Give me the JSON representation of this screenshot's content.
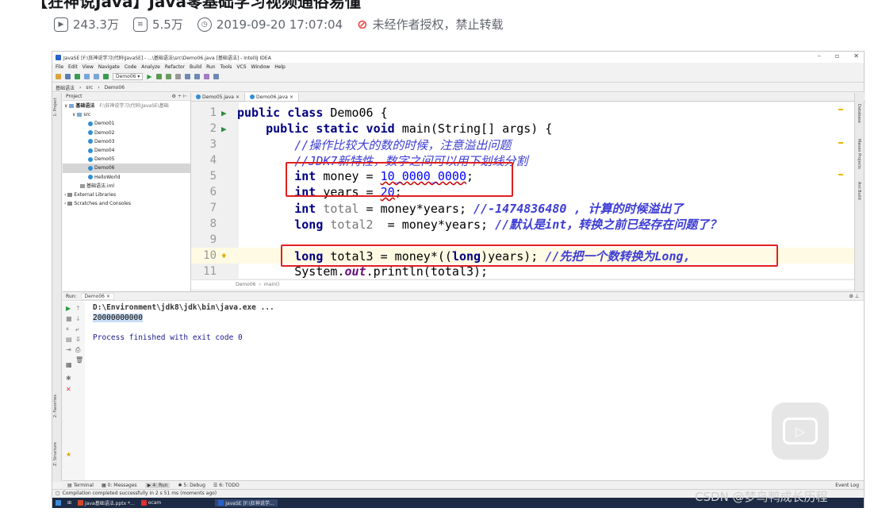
{
  "page": {
    "title": "【狂神说Java】Java零基础学习视频通俗易懂",
    "views": "243.3万",
    "danmaku": "5.5万",
    "date": "2019-09-20 17:07:04",
    "notice": "未经作者授权，禁止转载"
  },
  "ide": {
    "window_title": "JavaSE [F:\\狂神说学习\\代码\\JavaSE] - ...\\基础语法\\src\\Demo06.java [基础语法] - IntelliJ IDEA",
    "menu": [
      "File",
      "Edit",
      "View",
      "Navigate",
      "Code",
      "Analyze",
      "Refactor",
      "Build",
      "Run",
      "Tools",
      "VCS",
      "Window",
      "Help"
    ],
    "toolbar_config": "Demo06",
    "breadcrumb": [
      "基础语法",
      "src",
      "Demo06"
    ],
    "project": {
      "header": "Project",
      "root": "基础语法",
      "root_path": "F:\\狂神说学习\\代码\\JavaSE\\基础",
      "src": "src",
      "classes": [
        "Demo01",
        "Demo02",
        "Demo03",
        "Demo04",
        "Demo05",
        "Demo06",
        "HelloWorld"
      ],
      "iml": "基础语法.iml",
      "external": "External Libraries",
      "scratches": "Scratches and Consoles"
    },
    "tabs": [
      "Demo05.java",
      "Demo06.java"
    ],
    "editor": {
      "lines": [
        {
          "n": "1"
        },
        {
          "n": "2"
        },
        {
          "n": "3"
        },
        {
          "n": "4"
        },
        {
          "n": "5"
        },
        {
          "n": "6"
        },
        {
          "n": "7"
        },
        {
          "n": "8"
        },
        {
          "n": "9"
        },
        {
          "n": "10"
        },
        {
          "n": "11"
        }
      ],
      "comment3": "//操作比较大的数的时候，注意溢出问题",
      "comment4": "//JDK7新特性，数字之间可以用下划线分割",
      "money_value": "10_0000_0000",
      "years_value": "20",
      "comment7": "//-1474836480 , 计算的时候溢出了",
      "comment8": "//默认是int，转换之前已经存在问题了？",
      "comment10": "//先把一个数转换为Long,"
    },
    "code_breadcrumb": [
      "Demo06",
      "main()"
    ],
    "side_tools": [
      "Database",
      "Maven Projects",
      "Ant Build"
    ],
    "left_tools": [
      "1: Project",
      "2: Favorites",
      "Z: Structure"
    ],
    "run": {
      "label": "Run:",
      "config": "Demo06",
      "cmd": "D:\\Environment\\jdk8\\jdk\\bin\\java.exe ...",
      "output": "20000000000",
      "exit": "Process finished with exit code 0"
    },
    "bottom_tabs": [
      "Terminal",
      "0: Messages",
      "4: Run",
      "5: Debug",
      "6: TODO"
    ],
    "event_log": "Event Log",
    "status": "Compilation completed successfully in 2 s 51 ms (moments ago)",
    "taskbar": [
      "Java基础语法.pptx *...",
      "ocam",
      "JavaSE [F:\\狂神说学..."
    ]
  },
  "overlay": {
    "watermark": "CSDN @梦鸟鸭成长历程"
  },
  "colors": {
    "keyword": "#000080",
    "comment": "#3d3dd4",
    "number": "#0000ff",
    "highlight_box": "#e02020",
    "current_line": "#fffae3"
  }
}
